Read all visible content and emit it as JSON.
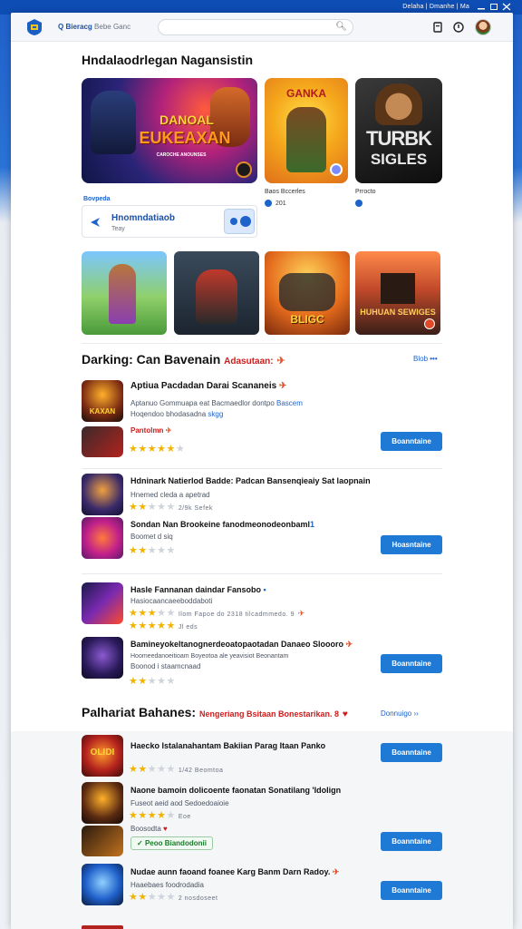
{
  "topbar": {
    "right_text": "Delaha | Dmanhe | Ma"
  },
  "header": {
    "breadcrumb_main": "Bieracg",
    "breadcrumb_sub": "Bebe Ganc",
    "search_placeholder": ""
  },
  "page_title": "Hndalaodrlegan Nagansistin",
  "featured": {
    "hero_main": {
      "line1": "DANOAL",
      "line2": "EUKEAXAN",
      "caption": "CAROCHE ANOUNSES"
    },
    "hero_mid": {
      "title": "GANKA",
      "caption": "Baos Bccerles",
      "count": "201"
    },
    "hero_right": {
      "line1": "TURBK",
      "line2": "SIGLES",
      "caption": "Prrocto"
    },
    "promo": {
      "label": "Bovpeda",
      "title": "Hnomndatiaob",
      "sub": "Teay"
    }
  },
  "tiles": [
    {
      "name": "tile-hero-girl"
    },
    {
      "name": "tile-warriors"
    },
    {
      "name": "tile-soldiers",
      "label": "BLIGC"
    },
    {
      "name": "tile-castle",
      "label": "HUHUAN SEWIGES"
    }
  ],
  "section1": {
    "title": "Darking: Can Bavenain",
    "badge": "Adasutaan:",
    "more": "Blob"
  },
  "apps": [
    {
      "title": "Aptiua Pacdadan Darai Scananeis",
      "sub1": "Aptanuo Gommuapa eat Bacmaedlor dontpo",
      "sub1_blue": "Bascem",
      "sub2": "Hoqendoo bhodasadna",
      "sub2_blue": "skgg",
      "icon_label": "KAXAN",
      "sub_title": "Pantolmn",
      "stars": 4.5,
      "button": "Boanntaine"
    },
    {
      "title": "Hdninark Natierlod Badde: Padcan Bansenqieaiy Sat laopnain",
      "sub1": "Hnemed cleda a apetrad",
      "stars_a": 2,
      "stars_a_text": "2/9k  Sefek",
      "title2": "Sondan Nan Brookeine fanodmeonodeonbaml",
      "sub2": "Boomet d siq",
      "stars_b": 2,
      "button": "Hoasntaine"
    },
    {
      "title": "Hasle Fannanan daindar Fansobo",
      "sub1": "Hasiocaancaeeboddaboti",
      "stars_a": 3,
      "stars_a_text": "Ilom  Fapoe  do 2318  tilcadmmedo. 9",
      "stars_b": 5,
      "stars_b_text": "Jl eds",
      "title2": "Bamineyokeltanognerdeoatopaotadan Danaeo Sloooro",
      "sub2": "Hoomeedanoeitioam Boyeotoa ale yeavisiot Beonantam",
      "sub3": "Boonod i staamcnaad",
      "stars_c": 2,
      "button": "Boanntaine"
    }
  ],
  "section2": {
    "title": "Palhariat Bahanes:",
    "badge": "Nengeriang Bsitaan Bonestarikan. 8",
    "more": "Donnuigo"
  },
  "bottom_apps": [
    {
      "title": "Haecko Istalanahantam Bakiian Parag Itaan Panko",
      "icon_label": "OLIDI",
      "stars": 2,
      "stars_text": "1/42 Beomtoa",
      "button": "Boanntaine"
    },
    {
      "title": "Naone bamoin dolicoente faonatan Sonatilang 'Idolign",
      "sub": "Fuseot aeid aod Sedoedoaioie",
      "stars": 4,
      "stars_text": "Eoe",
      "tag_prefix": "Boosodta",
      "tag": "Peoo Biandodonii",
      "button": "Boanntaine"
    },
    {
      "title": "Nudae aunn faoand foanee Karg Banm Darn Radoy.",
      "sub": "Haaebaes foodrodadia",
      "stars": 2,
      "stars_text": "2 nosdoseet",
      "button": "Boanntaine"
    }
  ]
}
